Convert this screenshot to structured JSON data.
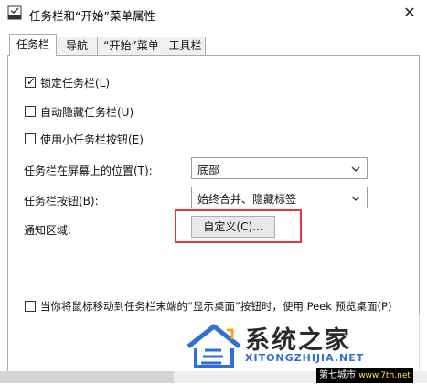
{
  "window": {
    "title": "任务栏和“开始”菜单属性",
    "close_glyph": "✕"
  },
  "tabs": [
    {
      "label": "任务栏",
      "active": true
    },
    {
      "label": "导航",
      "active": false
    },
    {
      "label": "“开始”菜单",
      "active": false
    },
    {
      "label": "工具栏",
      "active": false
    }
  ],
  "checkboxes": {
    "lock_taskbar": {
      "label": "锁定任务栏(L)",
      "checked": true
    },
    "auto_hide": {
      "label": "自动隐藏任务栏(U)",
      "checked": false
    },
    "small_buttons": {
      "label": "使用小任务栏按钮(E)",
      "checked": false
    },
    "peek": {
      "label": "当你将鼠标移动到任务栏末端的“显示桌面”按钮时，使用 Peek 预览桌面(P)",
      "checked": false
    }
  },
  "position": {
    "label": "任务栏在屏幕上的位置(T):",
    "value": "底部"
  },
  "buttons_setting": {
    "label": "任务栏按钮(B):",
    "value": "始终合并、隐藏标签"
  },
  "notification": {
    "label": "通知区域:",
    "button_label": "自定义(C)..."
  },
  "colors": {
    "highlight_border": "#e23a3a",
    "watermark_blue": "#2f6fd6"
  },
  "watermark": {
    "title": "系统之家",
    "url": "XITONGZHIJIA.NET",
    "corner_label": "第七城市",
    "corner_url": "www.7th.net"
  }
}
